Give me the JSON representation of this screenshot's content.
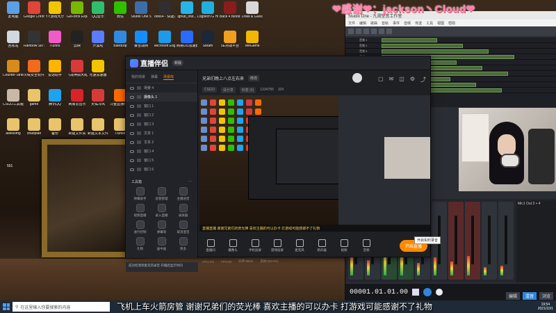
{
  "danmaku": {
    "thanks_text": "❤感谢❤：jackson丶Cloud❤",
    "marquee": "飞机上车火箭房管 谢谢兄弟们的荧光棒 喜欢主播的可以办卡 打游戏可能感谢不了礼物"
  },
  "desktop_icons": [
    {
      "label": "此电脑",
      "color": "#5aa0e6"
    },
    {
      "label": "Google Chrome",
      "color": "#e0453a"
    },
    {
      "label": "YY游戏大厅",
      "color": "#f2c500"
    },
    {
      "label": "GeForce Experience",
      "color": "#76b900"
    },
    {
      "label": "QQ音乐",
      "color": "#2fbf6c"
    },
    {
      "label": "微信",
      "color": "#2dc100"
    },
    {
      "label": "Studio One 5",
      "color": "#3a6ea8"
    },
    {
      "label": "obs64 - 快捷方式",
      "color": "#302e31"
    },
    {
      "label": "lghub_inst...",
      "color": "#27b5e8"
    },
    {
      "label": "Logitech G HUB",
      "color": "#1fb0e0"
    },
    {
      "label": "Back 4 Blood Beta",
      "color": "#8a1c1c"
    },
    {
      "label": "Draw & Guess",
      "color": "#d8d8d8"
    },
    {
      "label": "回收站",
      "color": "#d0d8e0"
    },
    {
      "label": "Rainbow Six Siege",
      "color": "#333333"
    },
    {
      "label": "iTunes",
      "color": "#f25ac8"
    },
    {
      "label": "剪映",
      "color": "#222222"
    },
    {
      "label": "开黑啦",
      "color": "#5a7cff"
    },
    {
      "label": "Bandizip",
      "color": "#2f8be0"
    },
    {
      "label": "暴雪战网",
      "color": "#148eff"
    },
    {
      "label": "Microsoft Edge",
      "color": "#1e9be8"
    },
    {
      "label": "网易UU加速器",
      "color": "#2a6bff"
    },
    {
      "label": "Steam",
      "color": "#1b2838"
    },
    {
      "label": "5E对战平台",
      "color": "#f0a020"
    },
    {
      "label": "WeGame",
      "color": "#f2b705"
    },
    {
      "label": "Counter-Strike: Global Of...",
      "color": "#d88a1a"
    },
    {
      "label": "火绒安全软件",
      "color": "#f26a1b"
    },
    {
      "label": "说话助手",
      "color": "#ffb400"
    },
    {
      "label": "《战神搞大乱斗》",
      "color": "#d83a3a"
    },
    {
      "label": "光速加速器",
      "color": "#f2c500"
    },
    {
      "label": "CSGO工具箱1.0.3",
      "color": "#c8b8a8"
    },
    {
      "label": "game",
      "color": "#e8c46a"
    },
    {
      "label": "腾讯QQ",
      "color": "#1fa3f0"
    },
    {
      "label": "网易云音乐",
      "color": "#d8232a"
    },
    {
      "label": "天佑冷风",
      "color": "#d83a3a"
    },
    {
      "label": "斗鱼直播伴侣",
      "color": "#ff6a00"
    },
    {
      "label": "awesomg",
      "color": "#e8c46a"
    },
    {
      "label": "zhaopian",
      "color": "#e8c46a"
    },
    {
      "label": "备份",
      "color": "#e8c46a"
    },
    {
      "label": "新建文件夹",
      "color": "#e8c46a"
    },
    {
      "label": "新建文本文件",
      "color": "#e8c46a"
    },
    {
      "label": "iTunes",
      "color": "#e8c46a"
    }
  ],
  "desktop_side_label": "551",
  "stream_app": {
    "app_name": "直播伴侣",
    "version_badge": "新版",
    "tabs": [
      "我的场景",
      "弹幕",
      "场景库"
    ],
    "active_tab": "场景库",
    "scenes": [
      {
        "label": "场景 4",
        "selected": false
      },
      {
        "label": "摄像头 1",
        "selected": true
      },
      {
        "label": "窗口 1",
        "selected": false
      },
      {
        "label": "窗口 2",
        "selected": false
      },
      {
        "label": "窗口 3",
        "selected": false
      },
      {
        "label": "文本 1",
        "selected": false
      },
      {
        "label": "文本 2",
        "selected": false
      },
      {
        "label": "窗口 4",
        "selected": false
      },
      {
        "label": "窗口 5",
        "selected": false
      },
      {
        "label": "窗口 6",
        "selected": false
      }
    ],
    "tools_title": "工具箱",
    "tools": [
      "弹幕助手",
      "房管管理",
      "主播语音",
      "视频直播",
      "录入直播",
      "录屏器",
      "进行控制",
      "弹幕等",
      "取消混音",
      "礼物",
      "画中画",
      "更多"
    ],
    "room_title": "兄弟们晚上八点左右来",
    "room_edit": "修改",
    "room_tags": [
      "CSGO",
      "请分享",
      "标签 (0)"
    ],
    "room_stats": [
      "1334785",
      "104"
    ],
    "subtitle_strip": "直播直播 谢谢兄弟们的荧光棒 喜欢主播的可以办卡 打游戏可能感谢不了礼物",
    "controls": [
      "直播间",
      "摄像头",
      "手机投屏",
      "游戏投屏",
      "麦克风",
      "扬声器",
      "视频",
      "音频"
    ],
    "go_live": "开始直播",
    "status": [
      "CPU:4%",
      "FPS:60",
      "码率:0kb/s",
      "丢帧:0(0.0%)"
    ],
    "notice": "成功检测到麦克风录音 开播后显示时间"
  },
  "tooltip": "开启实时录音",
  "daw": {
    "title": "Studio One - 九滑塑音工作室",
    "menu": [
      "文件",
      "编辑",
      "歌曲",
      "音轨",
      "事件",
      "音频",
      "传送",
      "工具",
      "视图",
      "帮助"
    ],
    "tracks": [
      "音频 1",
      "音频 2",
      "音频 3",
      "音频 4",
      "音频 5",
      "音频 6",
      "音频 7",
      "音频 8",
      "音频 9",
      "音频 10"
    ],
    "timecode": "00001.01.01.00",
    "bottom_tabs": [
      "编辑",
      "混音",
      "浏览"
    ],
    "active_tab": "混音",
    "right_panel": "Mic1 Out 3 + 4"
  },
  "taskbar": {
    "search_placeholder": "在这里输入你要搜索的内容",
    "time": "19:54",
    "date": "2021/10/1"
  }
}
